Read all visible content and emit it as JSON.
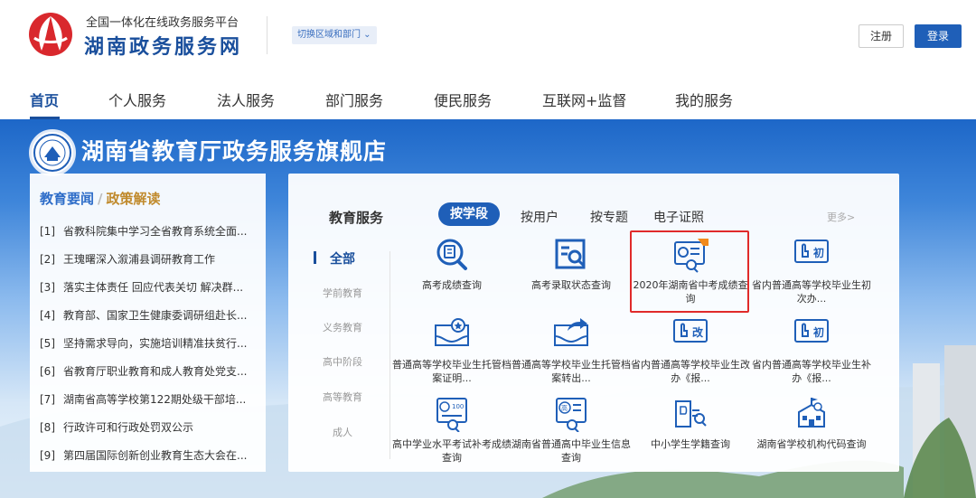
{
  "header": {
    "subtitle": "全国一体化在线政务服务平台",
    "site_name": "湖南政务服务网",
    "switch_label": "切换区域和部门 ⌄",
    "register_label": "注册",
    "login_label": "登录",
    "brand_color": "#1a4f9c"
  },
  "nav": {
    "items": [
      {
        "label": "首页",
        "active": true
      },
      {
        "label": "个人服务"
      },
      {
        "label": "法人服务"
      },
      {
        "label": "部门服务"
      },
      {
        "label": "便民服务"
      },
      {
        "label": "互联网+监督"
      },
      {
        "label": "我的服务"
      }
    ]
  },
  "store": {
    "title": "湖南省教育厅政务服务旗舰店"
  },
  "news": {
    "tab_news": "教育要闻",
    "separator": "/",
    "tab_policy": "政策解读",
    "items": [
      {
        "index": "[1]",
        "text": "省教科院集中学习全省教育系统全面..."
      },
      {
        "index": "[2]",
        "text": "王瑰曙深入溆浦县调研教育工作"
      },
      {
        "index": "[3]",
        "text": "落实主体责任 回应代表关切 解决群..."
      },
      {
        "index": "[4]",
        "text": "教育部、国家卫生健康委调研组赴长..."
      },
      {
        "index": "[5]",
        "text": "坚持需求导向，实施培训精准扶贫行..."
      },
      {
        "index": "[6]",
        "text": "省教育厅职业教育和成人教育处党支..."
      },
      {
        "index": "[7]",
        "text": "湖南省高等学校第122期处级干部培..."
      },
      {
        "index": "[8]",
        "text": "行政许可和行政处罚双公示"
      },
      {
        "index": "[9]",
        "text": "第四届国际创新创业教育生态大会在..."
      }
    ]
  },
  "services": {
    "title": "教育服务",
    "tabs": [
      "按学段",
      "按用户",
      "按专题",
      "电子证照"
    ],
    "more": "更多>",
    "categories": [
      "全部",
      "学前教育",
      "义务教育",
      "高中阶段",
      "高等教育",
      "成人"
    ],
    "items": [
      {
        "icon": "search-report-icon",
        "label": "高考成绩查询"
      },
      {
        "icon": "admission-status-icon",
        "label": "高考录取状态查询"
      },
      {
        "icon": "certificate-2020-icon",
        "label": "2020年湖南省中考成绩查询",
        "highlighted": true
      },
      {
        "icon": "hand-initial-icon",
        "label": "省内普通高等学校毕业生初次办...",
        "badge": "初"
      },
      {
        "icon": "document-star-icon",
        "label": "普通高等学校毕业生托管档案证明..."
      },
      {
        "icon": "document-transfer-icon",
        "label": "普通高等学校毕业生托管档案转出..."
      },
      {
        "icon": "hand-change-icon",
        "label": "省内普通高等学校毕业生改办《报...",
        "badge": "改"
      },
      {
        "icon": "hand-initial-icon",
        "label": "省内普通高等学校毕业生补办《报...",
        "badge": "初"
      },
      {
        "icon": "score-card-icon",
        "label": "高中学业水平考试补考成绩查询",
        "badge": "100"
      },
      {
        "icon": "student-info-icon",
        "label": "湖南省普通高中毕业生信息查询",
        "badge": "高"
      },
      {
        "icon": "student-record-icon",
        "label": "中小学生学籍查询"
      },
      {
        "icon": "school-building-icon",
        "label": "湖南省学校机构代码查询"
      }
    ]
  }
}
